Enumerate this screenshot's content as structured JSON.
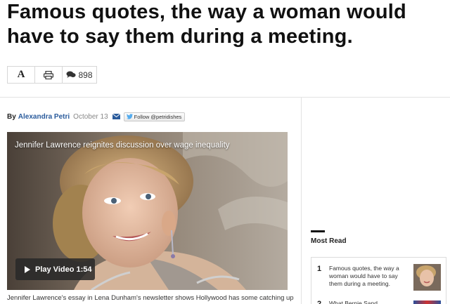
{
  "article": {
    "headline": "Famous quotes, the way a woman would have to say them during a meeting.",
    "byline_prefix": "By",
    "author": "Alexandra Petri",
    "date": "October 13",
    "follow_label": "Follow @petridishes"
  },
  "toolbar": {
    "font_label": "A",
    "comment_count": "898",
    "icons": [
      "font-size-icon",
      "print-icon",
      "comment-icon"
    ]
  },
  "video": {
    "title": "Jennifer Lawrence reignites discussion over wage inequality",
    "play_label": "Play Video 1:54"
  },
  "caption": "Jennifer Lawrence's essay in Lena Dunham's newsletter shows Hollywood has some catching up to",
  "most_read": {
    "title": "Most Read",
    "items": [
      {
        "rank": "1",
        "title": "Famous quotes, the way a woman would have to say them during a meeting."
      },
      {
        "rank": "2",
        "title": "What Bernie Sand"
      }
    ]
  },
  "colors": {
    "author_link": "#2a5b9c",
    "headline": "#111111"
  }
}
